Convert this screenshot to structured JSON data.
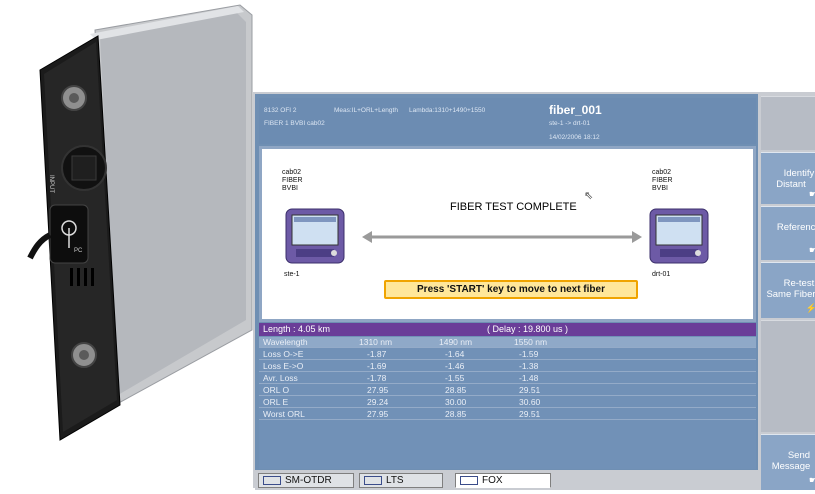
{
  "header": {
    "device": "8132 OFI 2",
    "meas": "Meas:IL+ORL+Length",
    "lambda": "Lambda:1310+1490+1550",
    "fiber_line": "FIBER 1   BVBI  cab02",
    "title": "fiber_001",
    "route": "ste-1 -> drt-01",
    "datetime": "14/02/2006   18:12"
  },
  "diagram": {
    "left_label": "cab02\nFIBER\nBVBI",
    "right_label": "cab02\nFIBER\nBVBI",
    "left_station": "ste-1",
    "right_station": "drt-01",
    "status": "FIBER TEST COMPLETE",
    "prompt": "Press 'START' key to move to next fiber"
  },
  "results": {
    "length": "Length : 4.05 km",
    "delay": "( Delay : 19.800 us )",
    "columns": [
      "Wavelength",
      "1310 nm",
      "1490 nm",
      "1550 nm"
    ],
    "rows": [
      [
        "Loss O->E",
        "-1.87",
        "-1.64",
        "-1.59"
      ],
      [
        "Loss E->O",
        "-1.69",
        "-1.46",
        "-1.38"
      ],
      [
        "Avr. Loss",
        "-1.78",
        "-1.55",
        "-1.48"
      ],
      [
        "ORL O",
        "27.95",
        "28.85",
        "29.51"
      ],
      [
        "ORL E",
        "29.24",
        "30.00",
        "30.60"
      ],
      [
        "Worst ORL",
        "27.95",
        "28.85",
        "29.51"
      ]
    ]
  },
  "softkeys": {
    "identify": "Identify\nDistant",
    "references": "References",
    "retest": "Re-test\nSame Fiber",
    "send": "Send\nMessage"
  },
  "tabs": {
    "tab1": "SM-OTDR",
    "tab2": "LTS",
    "tab3": "FOX"
  },
  "module": {
    "input_label": "INPUT",
    "pc_label": "PC"
  },
  "colors": {
    "screen_bg": "#6f8fb3",
    "purple_bar": "#6a3d98",
    "prompt_bg": "#ffe79a",
    "prompt_border": "#f0a400"
  }
}
